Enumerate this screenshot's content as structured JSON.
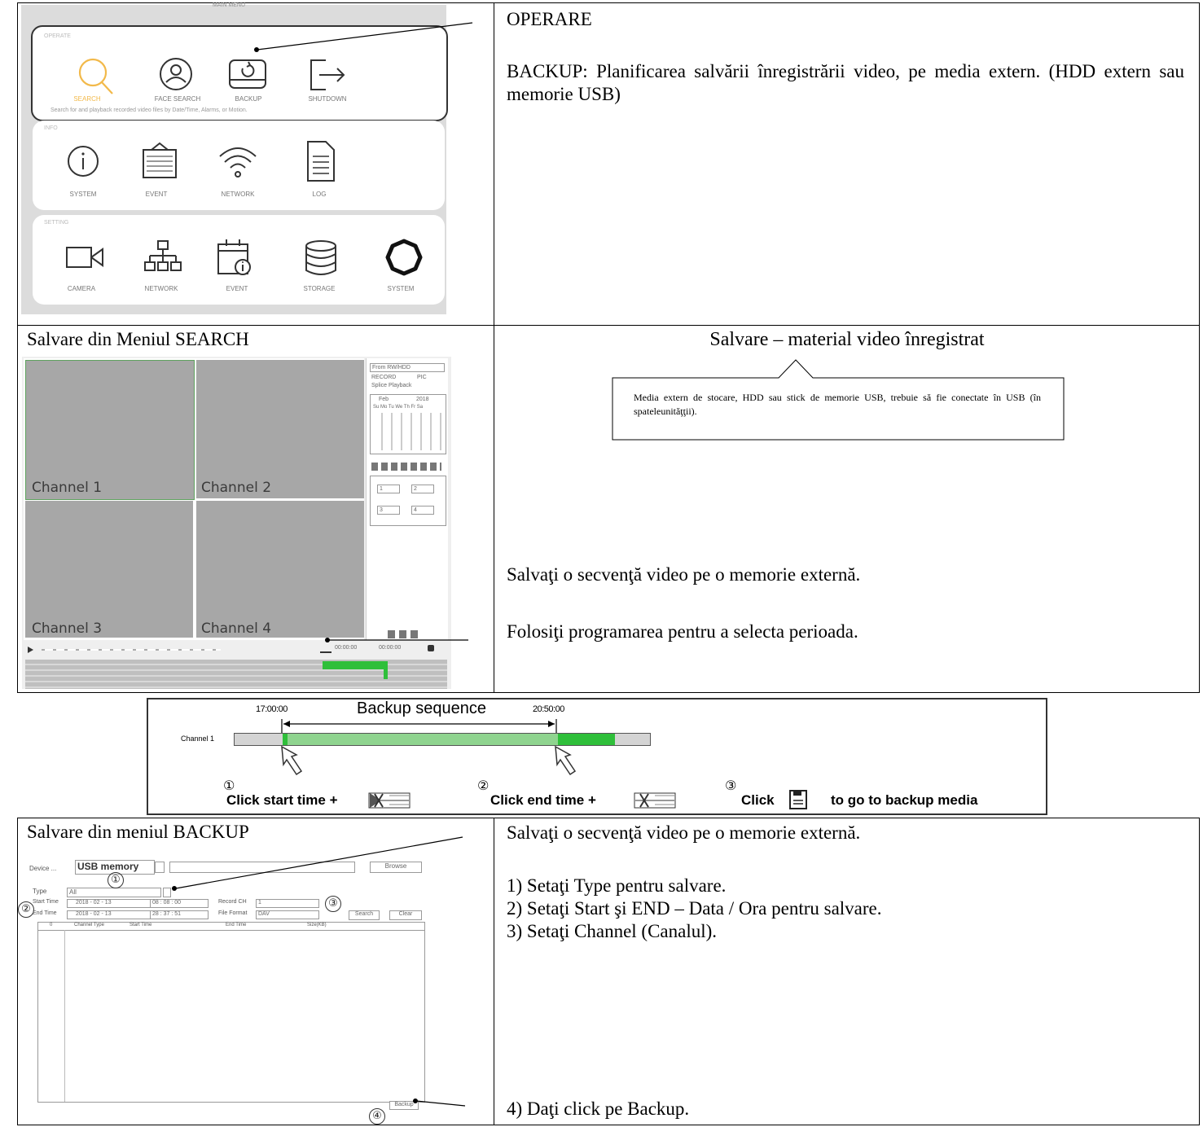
{
  "main_menu": {
    "title": "MAIN MENU",
    "operate": {
      "label": "OPERATE",
      "items": [
        "SEARCH",
        "FACE SEARCH",
        "BACKUP",
        "SHUTDOWN"
      ],
      "hint": "Search for and playback recorded video files by Date/Time, Alarms, or Motion."
    },
    "info": {
      "label": "INFO",
      "items": [
        "SYSTEM",
        "EVENT",
        "NETWORK",
        "LOG"
      ]
    },
    "setting": {
      "label": "SETTING",
      "items": [
        "CAMERA",
        "NETWORK",
        "EVENT",
        "STORAGE",
        "SYSTEM"
      ]
    }
  },
  "row1_right": {
    "heading": "OPERARE",
    "text": "BACKUP: Planificarea salvării înregistrării video, pe media extern. (HDD extern sau memorie USB)"
  },
  "row2_left": {
    "heading": "Salvare din Meniul SEARCH",
    "channels": [
      "Channel 1",
      "Channel 2",
      "Channel 3",
      "Channel 4"
    ],
    "side_panel": {
      "source": "From RW/HDD",
      "record": "RECORD",
      "pic": "PIC",
      "splice": "Splice Playback",
      "month": "Feb",
      "year": "2018",
      "weekdays": "Su Mo Tu We Th Fr Sa",
      "select_values": [
        "1",
        "2",
        "3",
        "4"
      ]
    },
    "time_start": "00:00:00",
    "time_end": "00:00:00"
  },
  "row2_right": {
    "title": "Salvare – material video înregistrat",
    "callout": "Media extern de stocare, HDD sau stick de memorie USB, trebuie să fie conectate în USB (în spateleunităţţii).",
    "text1": "Salvaţi o secvenţă video pe o memorie externă.",
    "text2": "Folosiţi programarea pentru a selecta perioada."
  },
  "row3": {
    "start_time": "17:00:00",
    "end_time": "20:50:00",
    "sequence_label": "Backup sequence",
    "channel_label": "Channel 1",
    "step1_num": "①",
    "step1": "Click start time +",
    "step2_num": "②",
    "step2": "Click end time +",
    "step3_num": "③",
    "step3_a": "Click",
    "step3_b": "to go to backup media"
  },
  "row4_left": {
    "heading": "Salvare din meniul BACKUP",
    "device_label": "Device ...",
    "device_value": "USB memory",
    "browse": "Browse",
    "type_label": "Type",
    "type_value": "All",
    "start_label": "Start Time",
    "start_date": "2018 - 02 - 13",
    "start_time": "08 : 08 : 00",
    "end_label": "End Time",
    "end_date": "2018 - 02 - 13",
    "end_time": "28 : 37 : 51",
    "record_ch_label": "Record CH",
    "record_ch_value": "1",
    "file_format_label": "File Format",
    "file_format_value": "DAV",
    "search": "Search",
    "clear": "Clear",
    "columns": [
      "0",
      "Channel Type",
      "Start Time",
      "End Time",
      "Size(KB)"
    ],
    "backup": "Backup",
    "markers": [
      "①",
      "②",
      "③",
      "④"
    ]
  },
  "row4_right": {
    "text1": "Salvaţi o secvenţă video pe o memorie externă.",
    "steps": [
      "1) Setaţi Type pentru salvare.",
      "2) Setaţi Start şi END – Data / Ora pentru salvare.",
      "3) Setaţi Channel (Canalul)."
    ],
    "step4": "4) Daţi click pe Backup."
  },
  "colors": {
    "search_orange": "#f2b94a",
    "timeline_green": "#2fbf3a",
    "channel_gray": "#a7a7a7"
  }
}
